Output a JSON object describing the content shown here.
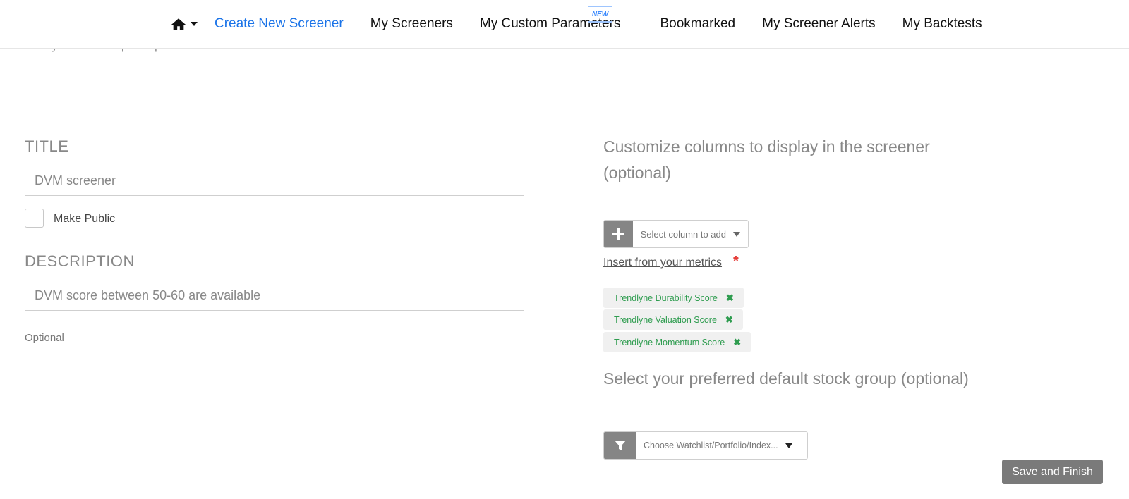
{
  "nav": {
    "items": [
      {
        "label": "Create New Screener",
        "active": true
      },
      {
        "label": "My Screeners"
      },
      {
        "label": "My Custom Parameters"
      },
      {
        "label": "Bookmarked"
      },
      {
        "label": "My Screener Alerts"
      },
      {
        "label": "My Backtests"
      }
    ],
    "new_badge": "NEW",
    "home_icon": "home-icon"
  },
  "subtitle_peek": "as yours in 2 simple steps",
  "form": {
    "title_label": "TITLE",
    "title_value": "DVM screener",
    "make_public_label": "Make Public",
    "make_public_checked": false,
    "description_label": "DESCRIPTION",
    "description_value": "DVM score between 50-60 are available",
    "optional_note": "Optional"
  },
  "columns": {
    "heading": "Customize columns to display in the screener (optional)",
    "select_placeholder": "Select column to add",
    "insert_link": "Insert from your metrics",
    "required_mark": "*",
    "tags": [
      {
        "label": "Trendlyne Durability Score"
      },
      {
        "label": "Trendlyne Valuation Score"
      },
      {
        "label": "Trendlyne Momentum Score"
      }
    ]
  },
  "stock_group": {
    "heading": "Select your preferred default stock group (optional)",
    "select_placeholder": "Choose Watchlist/Portfolio/Index..."
  },
  "actions": {
    "save_label": "Save and Finish"
  },
  "colors": {
    "accent": "#1a73e8",
    "tag_text": "#2e9c4f",
    "button_bg": "#7a7a7a",
    "required": "#e53935"
  }
}
